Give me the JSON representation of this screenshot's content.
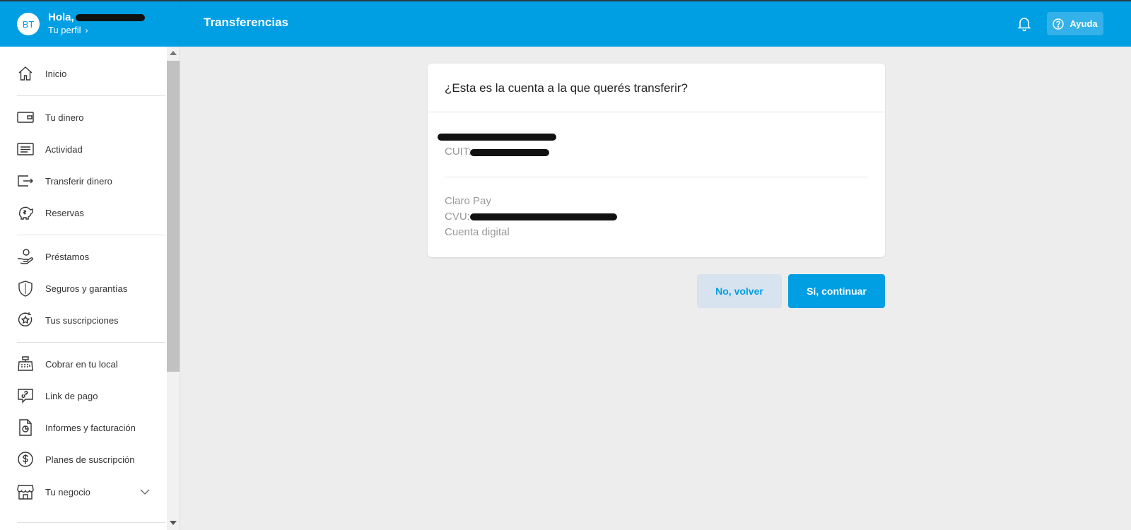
{
  "header": {
    "avatar_initials": "BT",
    "greeting": "Hola,",
    "profile_link": "Tu perfil",
    "title": "Transferencias",
    "help_label": "Ayuda",
    "brand_color": "#009ee3"
  },
  "sidebar": {
    "items": [
      {
        "label": "Inicio",
        "icon": "home-icon"
      },
      {
        "label": "Tu dinero",
        "icon": "wallet-icon"
      },
      {
        "label": "Actividad",
        "icon": "activity-icon"
      },
      {
        "label": "Transferir dinero",
        "icon": "transfer-icon"
      },
      {
        "label": "Reservas",
        "icon": "piggy-bank-icon"
      },
      {
        "label": "Préstamos",
        "icon": "loan-hand-icon"
      },
      {
        "label": "Seguros y garantías",
        "icon": "shield-icon"
      },
      {
        "label": "Tus suscripciones",
        "icon": "subscription-star-icon"
      },
      {
        "label": "Cobrar en tu local",
        "icon": "cash-register-icon"
      },
      {
        "label": "Link de pago",
        "icon": "payment-link-icon"
      },
      {
        "label": "Informes y facturación",
        "icon": "report-document-icon"
      },
      {
        "label": "Planes de suscripción",
        "icon": "dollar-cycle-icon"
      },
      {
        "label": "Tu negocio",
        "icon": "store-icon"
      }
    ]
  },
  "card": {
    "title": "¿Esta es la cuenta a la que querés transferir?",
    "cuit_label": "CUIT:",
    "bank": "Claro Pay",
    "cvu_label": "CVU:",
    "account_type": "Cuenta digital"
  },
  "actions": {
    "back_label": "No, volver",
    "continue_label": "Sí, continuar"
  }
}
